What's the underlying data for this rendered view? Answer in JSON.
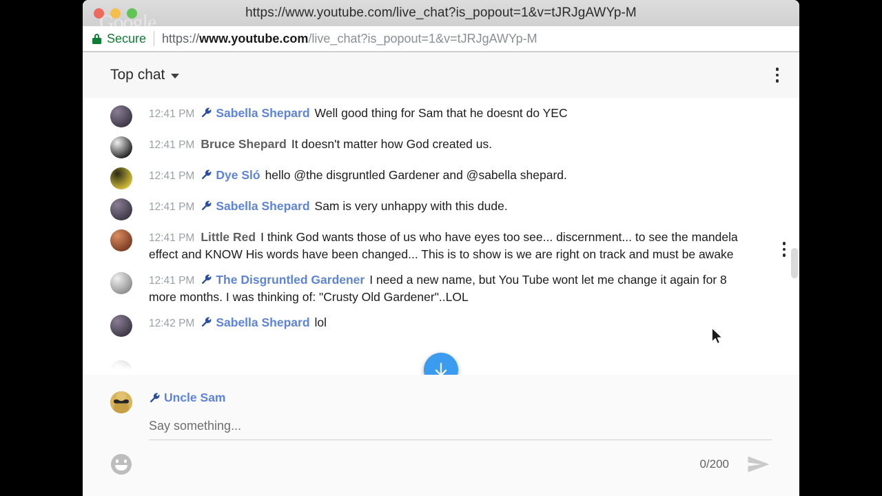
{
  "window": {
    "title": "https://www.youtube.com/live_chat?is_popout=1&v=tJRJgAWYp-M",
    "watermark": "Google",
    "traffic_lights": [
      "close",
      "minimize",
      "maximize"
    ]
  },
  "omnibox": {
    "security_label": "Secure",
    "security_icon": "lock-icon",
    "url_scheme": "https://",
    "url_host": "www.youtube.com",
    "url_path": "/live_chat?is_popout=1&v=tJRJgAWYp-M",
    "full_url": "https://www.youtube.com/live_chat?is_popout=1&v=tJRJgAWYp-M"
  },
  "chat_header": {
    "selector_label": "Top chat",
    "chevron_icon": "chevron-down-icon",
    "overflow_icon": "kebab-menu-icon"
  },
  "messages": [
    {
      "timestamp": "12:41 PM",
      "author": "Sabella Shepard",
      "is_moderator": true,
      "text": "Well good thing for Sam that he doesnt do YEC",
      "avatar_color_a": "#8a7d92",
      "avatar_color_b": "#3c3646"
    },
    {
      "timestamp": "12:41 PM",
      "author": "Bruce Shepard",
      "is_moderator": false,
      "text": "It doesn't matter how God created us.",
      "avatar_color_a": "#efefef",
      "avatar_color_b": "#1e1e1e"
    },
    {
      "timestamp": "12:41 PM",
      "author": "Dye Sló",
      "is_moderator": true,
      "text": "hello @the disgruntled Gardener and @sabella shepard.",
      "avatar_color_a": "#2a2a16",
      "avatar_color_b": "#d8c33a"
    },
    {
      "timestamp": "12:41 PM",
      "author": "Sabella Shepard",
      "is_moderator": true,
      "text": "Sam is very unhappy with this dude.",
      "avatar_color_a": "#8a7d92",
      "avatar_color_b": "#3c3646"
    },
    {
      "timestamp": "12:41 PM",
      "author": "Little Red",
      "is_moderator": false,
      "text": "I think God wants those of us who have eyes too see... discernment... to see the mandela effect and KNOW His words have been changed... This is to show is we are right on track and must be awake",
      "avatar_color_a": "#d98c5f",
      "avatar_color_b": "#7a3a22"
    },
    {
      "timestamp": "12:41 PM",
      "author": "The Disgruntled Gardener",
      "is_moderator": true,
      "text": "I need a new name, but You Tube wont let me change it again for 8 more months. I was thinking of: \"Crusty Old Gardener\"..LOL",
      "avatar_color_a": "#f0f0f0",
      "avatar_color_b": "#8c8c8c"
    },
    {
      "timestamp": "12:42 PM",
      "author": "Sabella Shepard",
      "is_moderator": true,
      "text": "lol",
      "avatar_color_a": "#8a7d92",
      "avatar_color_b": "#3c3646"
    }
  ],
  "cutoff_message": {
    "timestamp": "",
    "author": "",
    "is_moderator": false,
    "text": "",
    "avatar_color_a": "#e8e8e8",
    "avatar_color_b": "#202020"
  },
  "controls": {
    "scroll_down_icon": "arrow-down-icon",
    "scrollbar": "vertical-scrollbar",
    "message_overflow_icon": "kebab-menu-icon",
    "cursor_icon": "mouse-pointer-icon"
  },
  "composer": {
    "author": "Uncle Sam",
    "is_moderator": true,
    "input_value": "",
    "input_placeholder": "Say something...",
    "char_counter": "0/200",
    "emoji_icon": "emoji-smiley-icon",
    "send_icon": "send-arrow-icon"
  },
  "colors": {
    "moderator_name": "#5e84d8",
    "wrench": "#2b4f9e",
    "secure_green": "#0f7d35",
    "accent_blue": "#3b9bee",
    "timestamp_gray": "#9aa0a6"
  }
}
